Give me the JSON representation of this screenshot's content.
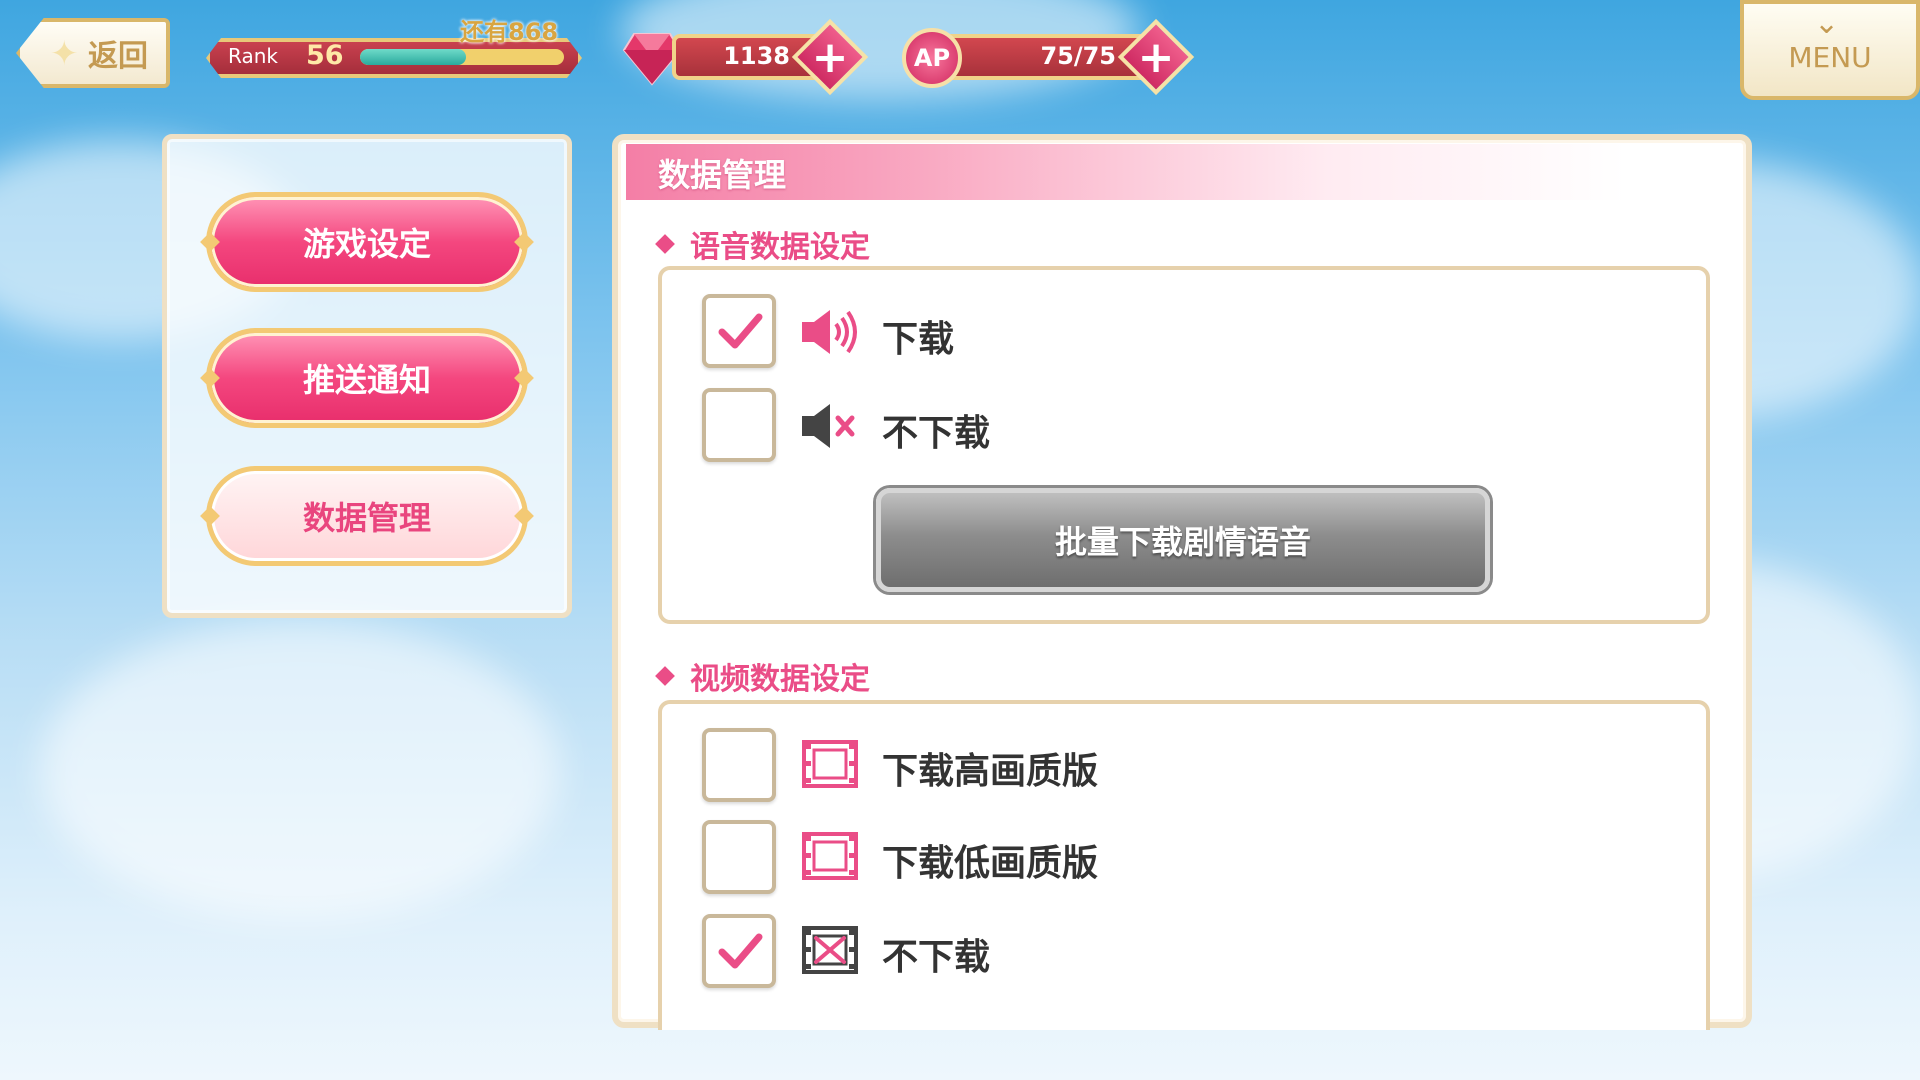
{
  "top_bar": {
    "back_label": "返回",
    "rank_label": "Rank",
    "rank_value": "56",
    "rank_remaining": "还有868",
    "rank_progress": 0.52,
    "gems": "1138",
    "ap": "75/75",
    "ap_label": "AP",
    "menu_label": "MENU"
  },
  "sidebar": {
    "items": [
      {
        "label": "游戏设定",
        "active": false
      },
      {
        "label": "推送通知",
        "active": false
      },
      {
        "label": "数据管理",
        "active": true
      }
    ]
  },
  "main": {
    "title": "数据管理",
    "voice_section": {
      "heading": "语音数据设定",
      "options": [
        {
          "label": "下载",
          "checked": true,
          "icon": "speaker-on-icon"
        },
        {
          "label": "不下载",
          "checked": false,
          "icon": "speaker-mute-icon"
        }
      ],
      "bulk_button": "批量下载剧情语音"
    },
    "video_section": {
      "heading": "视频数据设定",
      "options": [
        {
          "label": "下载高画质版",
          "checked": false,
          "icon": "film-icon"
        },
        {
          "label": "下载低画质版",
          "checked": false,
          "icon": "film-icon"
        },
        {
          "label": "不下载",
          "checked": true,
          "icon": "film-off-icon"
        }
      ]
    }
  },
  "colors": {
    "accent_pink": "#ea4d87",
    "gold": "#e6c27a",
    "sky": "#7cc3ee"
  }
}
